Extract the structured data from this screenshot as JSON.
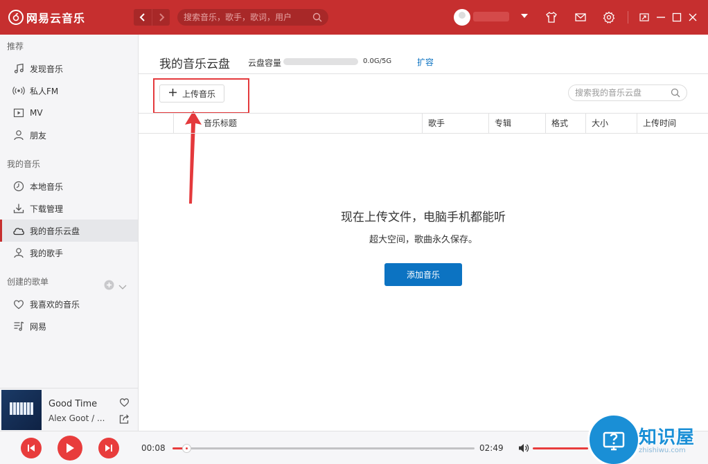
{
  "app": {
    "logo_text": "网易云音乐",
    "brand_color": "#c62f2f",
    "search_placeholder": "搜索音乐，歌手，歌词，用户"
  },
  "sidebar": {
    "section_recommend": "推荐",
    "recommend_items": [
      {
        "label": "发现音乐",
        "icon": "music-note-icon"
      },
      {
        "label": "私人FM",
        "icon": "radio-icon"
      },
      {
        "label": "MV",
        "icon": "video-icon"
      },
      {
        "label": "朋友",
        "icon": "friends-icon"
      }
    ],
    "section_my_music": "我的音乐",
    "my_music_items": [
      {
        "label": "本地音乐",
        "icon": "local-music-icon"
      },
      {
        "label": "下载管理",
        "icon": "download-icon"
      },
      {
        "label": "我的音乐云盘",
        "icon": "cloud-icon",
        "active": true
      },
      {
        "label": "我的歌手",
        "icon": "singer-icon"
      }
    ],
    "section_created": "创建的歌单",
    "playlist_items": [
      {
        "label": "我喜欢的音乐",
        "icon": "heart-icon"
      },
      {
        "label": "网易",
        "icon": "playlist-icon"
      }
    ]
  },
  "now_playing": {
    "title": "Good Time",
    "artist": "Alex Goot / ..."
  },
  "player": {
    "current_time": "00:08",
    "total_time": "02:49",
    "progress": 0.047,
    "accent_color": "#e83c3c"
  },
  "main": {
    "page_title": "我的音乐云盘",
    "capacity_label": "云盘容量",
    "capacity_text": "0.0G/5G",
    "capacity_fraction": 0.0,
    "expand_label": "扩容",
    "upload_label": "上传音乐",
    "cloud_search_placeholder": "搜索我的音乐云盘",
    "columns": [
      "音乐标题",
      "歌手",
      "专辑",
      "格式",
      "大小",
      "上传时间"
    ],
    "empty_title": "现在上传文件，电脑手机都能听",
    "empty_subtitle": "超大空间，歌曲永久保存。",
    "add_music_label": "添加音乐",
    "link_color": "#0c73c2"
  },
  "watermark": {
    "text": "知识屋",
    "url": "zhishiwu.com"
  }
}
